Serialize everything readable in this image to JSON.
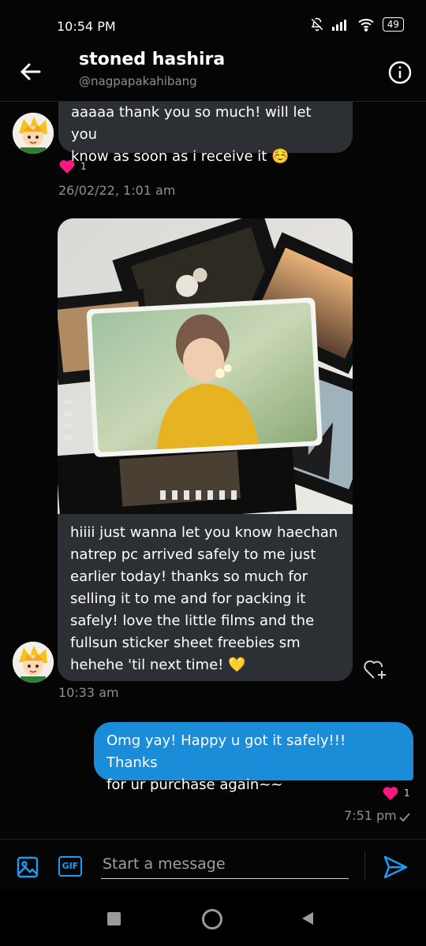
{
  "status_bar": {
    "time": "10:54 PM",
    "battery": "49"
  },
  "header": {
    "title": "stoned hashira",
    "handle": "@nagpapakahibang"
  },
  "messages": {
    "m1": {
      "line1": "aaaaa thank you so much! will let you",
      "line2": "know as soon as i receive it ☺️",
      "reaction_count": "1",
      "timestamp": "26/02/22, 1:01 am"
    },
    "m2": {
      "lines": [
        "hiiii just wanna let you know haechan",
        "natrep pc arrived safely to me just",
        "earlier today! thanks so much for",
        "selling it to me and for packing it",
        "safely!  love the little films and the",
        "fullsun sticker sheet freebies sm",
        "hehehe 'til next time! 💛"
      ],
      "timestamp": "10:33 am"
    },
    "m3": {
      "line1": "Omg yay! Happy u got it safely!!! Thanks",
      "line2": "for ur purchase again~~",
      "reaction_count": "1",
      "timestamp": "7:51 pm"
    }
  },
  "composer": {
    "placeholder": "Start a message",
    "gif_label": "GIF"
  },
  "colors": {
    "accent": "#1a8cd8",
    "heart": "#f91880",
    "incoming_bubble": "#2c2f33"
  }
}
